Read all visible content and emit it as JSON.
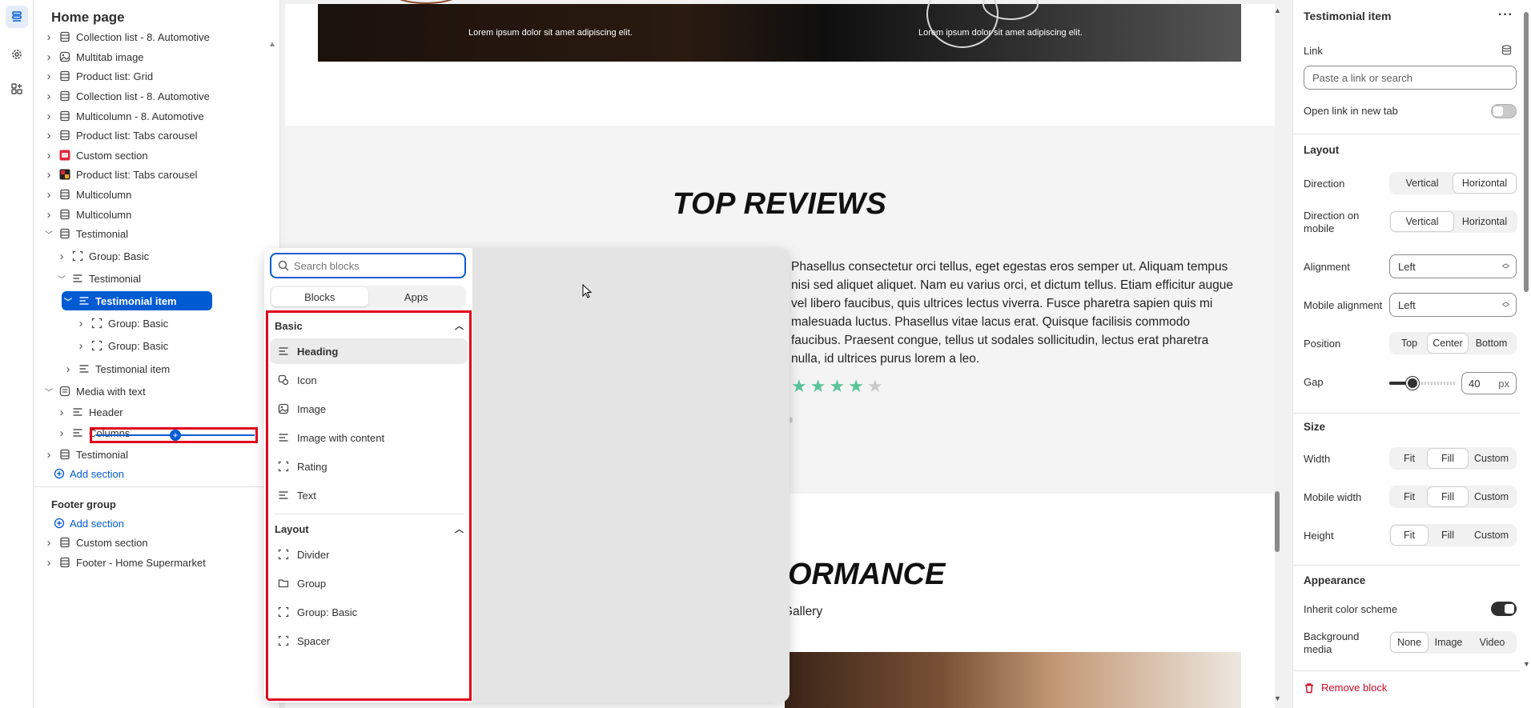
{
  "sidebar": {
    "title": "Home page",
    "items": [
      {
        "label": "Collection list - 8. Automotive",
        "icon": "section-icon"
      },
      {
        "label": "Multitab image",
        "icon": "image-icon"
      },
      {
        "label": "Product list: Grid",
        "icon": "section-icon"
      },
      {
        "label": "Collection list - 8. Automotive",
        "icon": "section-icon"
      },
      {
        "label": "Multicolumn - 8. Automotive",
        "icon": "section-icon"
      },
      {
        "label": "Product list: Tabs carousel",
        "icon": "section-icon"
      },
      {
        "label": "Custom section",
        "icon": "app-red-icon"
      },
      {
        "label": "Product list: Tabs carousel",
        "icon": "app-multi-icon"
      },
      {
        "label": "Multicolumn",
        "icon": "section-icon"
      },
      {
        "label": "Multicolumn",
        "icon": "section-icon"
      },
      {
        "label": "Testimonial",
        "icon": "section-icon"
      },
      {
        "label": "Group: Basic",
        "icon": "group-icon"
      },
      {
        "label": "Testimonial",
        "icon": "text-icon"
      },
      {
        "label": "Testimonial item",
        "icon": "text-icon"
      },
      {
        "label": "Group: Basic",
        "icon": "group-icon"
      },
      {
        "label": "Group: Basic",
        "icon": "group-icon"
      },
      {
        "label": "Testimonial item",
        "icon": "text-icon"
      },
      {
        "label": "Media with text",
        "icon": "media-icon"
      },
      {
        "label": "Header",
        "icon": "text-icon"
      },
      {
        "label": "Columns",
        "icon": "text-icon"
      },
      {
        "label": "Testimonial",
        "icon": "section-icon"
      }
    ],
    "add_section": "Add section",
    "footer_group": "Footer group",
    "footer_add_section": "Add section",
    "footer_items": [
      {
        "label": "Custom section"
      },
      {
        "label": "Footer - Home Supermarket"
      }
    ]
  },
  "preview": {
    "banner_caption_left": "Lorem ipsum dolor sit amet adipiscing elit.",
    "banner_caption_right": "Lorem ipsum dolor sit amet adipiscing elit.",
    "reviews_title": "TOP REVIEWS",
    "review_text": "Phasellus consectetur orci tellus, eget egestas eros semper ut. Aliquam tempus nisi sed aliquet aliquet. Nam eu varius orci, et dictum tellus. Etiam efficitur augue vel libero faucibus, quis ultrices lectus viverra. Fusce pharetra sapien quis mi malesuada luctus. Phasellus vitae lacus erat. Quisque facilisis commodo faucibus. Praesent congue, tellus ut sodales sollicitudin, lectus erat pharetra nulla, id ultrices purus lorem a leo.",
    "rating": 4,
    "rating_max": 5,
    "star_color": "#5bc49a",
    "perf_title": "ORMANCE",
    "gallery_text": "Gallery"
  },
  "picker": {
    "search_placeholder": "Search blocks",
    "tabs": [
      {
        "label": "Blocks"
      },
      {
        "label": "Apps"
      }
    ],
    "basic_heading": "Basic",
    "basic_items": [
      {
        "label": "Heading",
        "icon": "text-icon"
      },
      {
        "label": "Icon",
        "icon": "icon-icon"
      },
      {
        "label": "Image",
        "icon": "image-icon"
      },
      {
        "label": "Image with content",
        "icon": "text-icon"
      },
      {
        "label": "Rating",
        "icon": "group-icon"
      },
      {
        "label": "Text",
        "icon": "text-icon"
      }
    ],
    "layout_heading": "Layout",
    "layout_items": [
      {
        "label": "Divider",
        "icon": "group-icon"
      },
      {
        "label": "Group",
        "icon": "folder-icon"
      },
      {
        "label": "Group: Basic",
        "icon": "group-icon"
      },
      {
        "label": "Spacer",
        "icon": "group-icon"
      }
    ]
  },
  "settings": {
    "title": "Testimonial item",
    "link_label": "Link",
    "link_placeholder": "Paste a link or search",
    "open_new_tab_label": "Open link in new tab",
    "layout_heading": "Layout",
    "direction_label": "Direction",
    "direction_options": [
      "Vertical",
      "Horizontal"
    ],
    "direction_selected": "Horizontal",
    "direction_mobile_label": "Direction on mobile",
    "direction_mobile_options": [
      "Vertical",
      "Horizontal"
    ],
    "direction_mobile_selected": "Vertical",
    "alignment_label": "Alignment",
    "alignment_value": "Left",
    "mobile_alignment_label": "Mobile alignment",
    "mobile_alignment_value": "Left",
    "position_label": "Position",
    "position_options": [
      "Top",
      "Center",
      "Bottom"
    ],
    "position_selected": "Center",
    "gap_label": "Gap",
    "gap_value": "40",
    "gap_unit": "px",
    "gap_fraction": 0.35,
    "size_heading": "Size",
    "width_label": "Width",
    "width_options": [
      "Fit",
      "Fill",
      "Custom"
    ],
    "width_selected": "Fill",
    "mobile_width_label": "Mobile width",
    "mobile_width_options": [
      "Fit",
      "Fill",
      "Custom"
    ],
    "mobile_width_selected": "Fill",
    "height_label": "Height",
    "height_options": [
      "Fit",
      "Fill",
      "Custom"
    ],
    "height_selected": "Fit",
    "appearance_heading": "Appearance",
    "inherit_color_label": "Inherit color scheme",
    "inherit_color_on": true,
    "open_new_tab_on": false,
    "background_media_label": "Background media",
    "background_media_options": [
      "None",
      "Image",
      "Video"
    ],
    "background_media_selected": "None",
    "remove_label": "Remove block",
    "accent_color": "#005bd3",
    "danger_color": "#c70a24"
  }
}
